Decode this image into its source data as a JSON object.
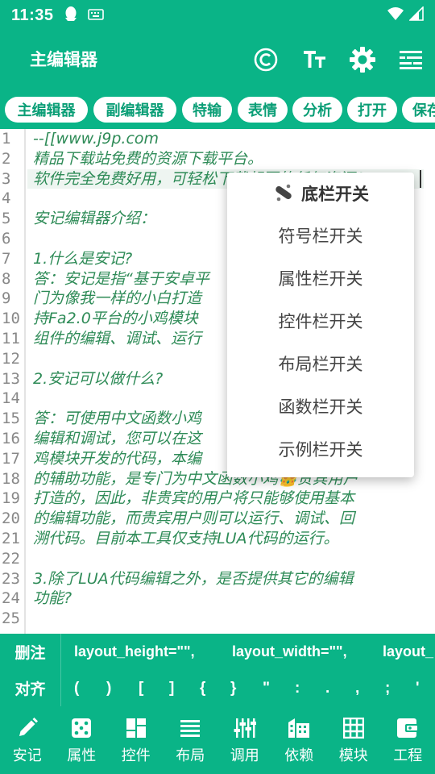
{
  "status_bar": {
    "time": "11:35"
  },
  "app_bar": {
    "title": "主编辑器"
  },
  "chips": [
    "主编辑器",
    "副编辑器",
    "特输",
    "表情",
    "分析",
    "打开",
    "保存"
  ],
  "editor": {
    "line_numbers": [
      "1",
      "2",
      "3",
      "4",
      "5",
      "6",
      "7",
      "8",
      "9",
      "10",
      "11",
      "12",
      "13",
      "14",
      "15",
      "16",
      "17",
      "18",
      "19",
      "20",
      "21",
      "22",
      "23",
      "24",
      "25"
    ],
    "lines": [
      "--[[www.j9p.com",
      "精品下载站免费的资源下载平台。",
      "软件完全免费好用，可轻松下载想要的任何资源！",
      "",
      "安记编辑器介绍：",
      "",
      "1.什么是安记?",
      "答：安记是指“基于安卓平",
      "门为像我一样的小白打造",
      "持Fa2.0平台的小鸡模块",
      "组件的编辑、调试、运行",
      "",
      "2.安记可以做什么?",
      "",
      "答：可使用中文函数小鸡",
      "编辑和调试，您可以在这",
      "鸡模块开发的代码，本编",
      "的辅助功能，是专门为中文函数小鸡👑贵宾用户",
      "打造的，因此，非贵宾的用户将只能够使用基本",
      "的编辑功能，而贵宾用户则可以运行、调试、回",
      "溯代码。目前本工具仅支持LUA代码的运行。",
      "",
      "3.除了LUA代码编辑之外，是否提供其它的编辑",
      "功能?",
      ""
    ]
  },
  "popup_menu": {
    "items": [
      "底栏开关",
      "符号栏开关",
      "属性栏开关",
      "控件栏开关",
      "布局栏开关",
      "函数栏开关",
      "示例栏开关"
    ]
  },
  "attr_bar": {
    "label": "删注",
    "items": [
      "layout_height=\"\",",
      "layout_width=\"\",",
      "layout_"
    ]
  },
  "symbol_bar": {
    "label": "对齐",
    "items": [
      "(",
      ")",
      "[",
      "]",
      "{",
      "}",
      "\"",
      ":",
      ".",
      ",",
      ";",
      "'"
    ]
  },
  "bottom_nav": {
    "items": [
      {
        "label": "安记",
        "icon": "pencil-icon"
      },
      {
        "label": "属性",
        "icon": "dice-icon"
      },
      {
        "label": "控件",
        "icon": "dashboard-icon"
      },
      {
        "label": "布局",
        "icon": "menu-lines-icon"
      },
      {
        "label": "调用",
        "icon": "equalizer-icon"
      },
      {
        "label": "依赖",
        "icon": "building-icon"
      },
      {
        "label": "模块",
        "icon": "grid-icon"
      },
      {
        "label": "工程",
        "icon": "wallet-icon"
      }
    ]
  },
  "colors": {
    "primary": "#0ab487",
    "code_text": "#2e8b57",
    "line_number": "#888888"
  }
}
